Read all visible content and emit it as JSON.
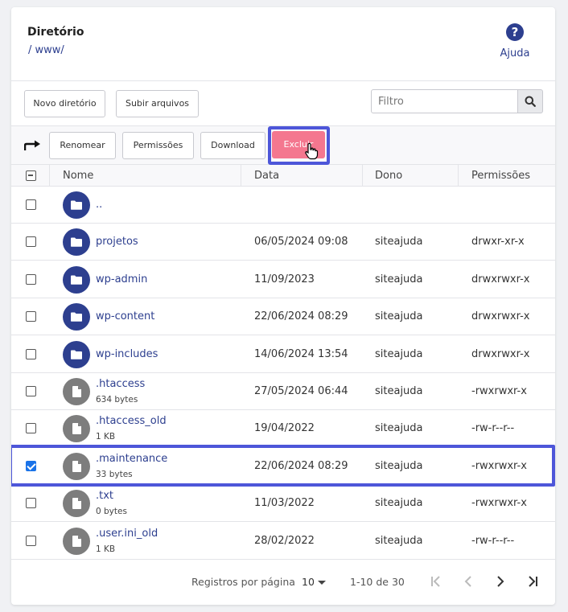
{
  "header": {
    "title": "Diretório",
    "path": "/ www/",
    "help_label": "Ajuda",
    "help_icon": "question-circle-icon"
  },
  "toolbar": {
    "new_dir_label": "Novo diretório",
    "upload_label": "Subir arquivos",
    "filter_placeholder": "Filtro",
    "rename_label": "Renomear",
    "permissions_label": "Permissões",
    "download_label": "Download",
    "delete_label": "Excluir"
  },
  "table": {
    "headers": {
      "name": "Nome",
      "date": "Data",
      "owner": "Dono",
      "permissions": "Permissões"
    },
    "rows": [
      {
        "type": "folder",
        "name": "..",
        "size": "",
        "date": "",
        "owner": "",
        "permissions": "",
        "checked": false
      },
      {
        "type": "folder",
        "name": "projetos",
        "size": "",
        "date": "06/05/2024 09:08",
        "owner": "siteajuda",
        "permissions": "drwxr-xr-x",
        "checked": false
      },
      {
        "type": "folder",
        "name": "wp-admin",
        "size": "",
        "date": "11/09/2023",
        "owner": "siteajuda",
        "permissions": "drwxrwxr-x",
        "checked": false
      },
      {
        "type": "folder",
        "name": "wp-content",
        "size": "",
        "date": "22/06/2024 08:29",
        "owner": "siteajuda",
        "permissions": "drwxrwxr-x",
        "checked": false
      },
      {
        "type": "folder",
        "name": "wp-includes",
        "size": "",
        "date": "14/06/2024 13:54",
        "owner": "siteajuda",
        "permissions": "drwxrwxr-x",
        "checked": false
      },
      {
        "type": "file",
        "name": ".htaccess",
        "size": "634 bytes",
        "date": "27/05/2024 06:44",
        "owner": "siteajuda",
        "permissions": "-rwxrwxr-x",
        "checked": false
      },
      {
        "type": "file",
        "name": ".htaccess_old",
        "size": "1 KB",
        "date": "19/04/2022",
        "owner": "siteajuda",
        "permissions": "-rw-r--r--",
        "checked": false
      },
      {
        "type": "file",
        "name": ".maintenance",
        "size": "33 bytes",
        "date": "22/06/2024 08:29",
        "owner": "siteajuda",
        "permissions": "-rwxrwxr-x",
        "checked": true
      },
      {
        "type": "file",
        "name": ".txt",
        "size": "0 bytes",
        "date": "11/03/2022",
        "owner": "siteajuda",
        "permissions": "-rwxrwxr-x",
        "checked": false
      },
      {
        "type": "file",
        "name": ".user.ini_old",
        "size": "1 KB",
        "date": "28/02/2022",
        "owner": "siteajuda",
        "permissions": "-rw-r--r--",
        "checked": false
      }
    ]
  },
  "pagination": {
    "per_page_label": "Registros por página",
    "per_page_value": "10",
    "range": "1-10 de 30"
  },
  "colors": {
    "primary": "#2d3f8f",
    "danger": "#f4778f",
    "highlight": "#4d56d9",
    "checkbox_checked": "#1a73e8"
  }
}
